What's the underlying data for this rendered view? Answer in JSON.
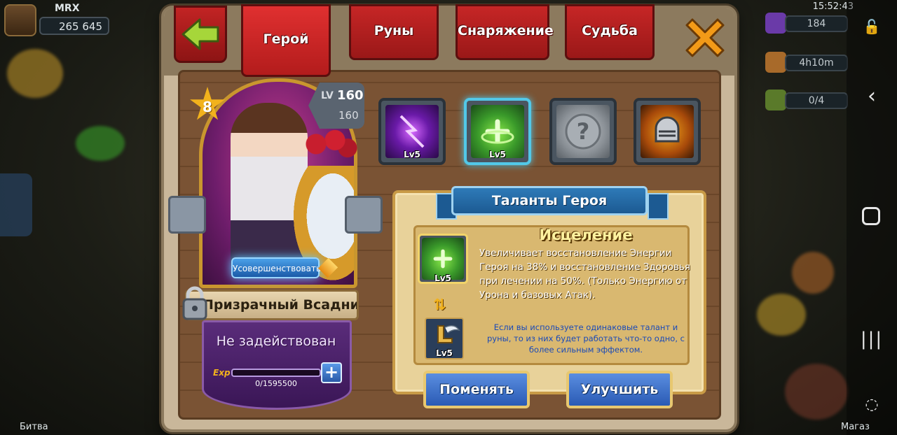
{
  "hud": {
    "player_name": "MRX",
    "gold": "265 645",
    "clock": "15:52:43",
    "gems": "184",
    "timer": "4h10m",
    "slots": "0/4",
    "bottom_left_label": "Битва",
    "bottom_right_label": "Магаз"
  },
  "tabs": {
    "hero": "Герой",
    "runes": "Руны",
    "equipment": "Снаряжение",
    "fate": "Судьба",
    "active": "hero"
  },
  "hero": {
    "stars": "8",
    "lv_label": "LV",
    "level": "160",
    "max_level": "160",
    "upgrade_label": "Усовершенствовать",
    "name": "Призрачный Всадник",
    "status": "Не задействован",
    "exp_label": "Exp",
    "exp_text": "0/1595500",
    "exp_fraction": 0,
    "exp_plus": "+"
  },
  "skills": [
    {
      "icon": "lightning-fist-icon",
      "level": "Lv5",
      "selected": false
    },
    {
      "icon": "healing-icon",
      "level": "Lv5",
      "selected": true
    },
    {
      "icon": "question-mark-icon",
      "level": "",
      "selected": false
    },
    {
      "icon": "knight-helmet-icon",
      "level": "",
      "selected": false
    }
  ],
  "talents": {
    "banner": "Таланты Героя",
    "skill_title": "Исцеление",
    "skill_level": "Lv5",
    "description": "Увеличивает восстановление Энергии Героя на 38% и восстановление Здоровья при лечении на 50%. (Только Энергию от Урона и базовых Атак).",
    "note": "Если вы используете одинаковые талант и руны, то из них будет работать что-то одно, с более сильным эффектом.",
    "rune_level": "Lv5",
    "swap_button": "Поменять",
    "upgrade_button": "Улучшить"
  },
  "colors": {
    "tab_red": "#c62626",
    "panel": "#c9b79a",
    "accent_blue": "#2a5ab4",
    "gold": "#f2b21c"
  }
}
